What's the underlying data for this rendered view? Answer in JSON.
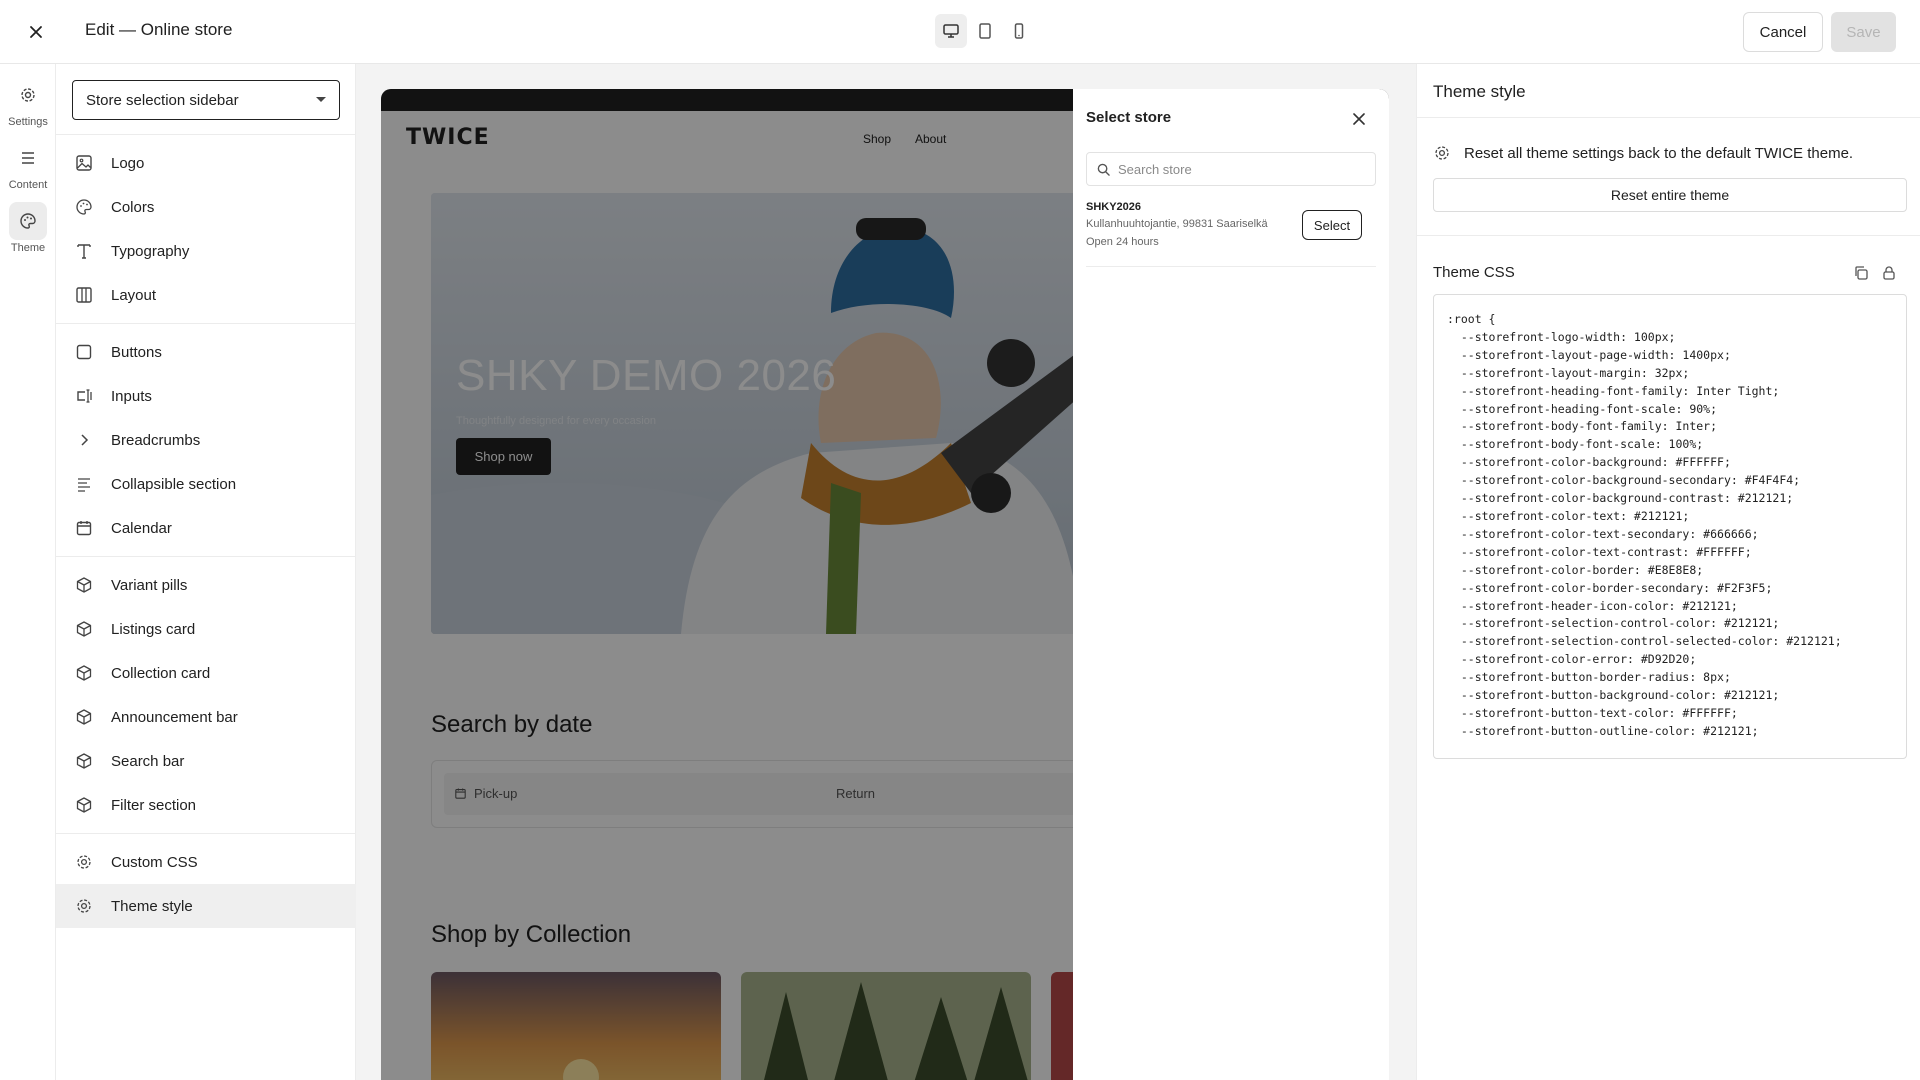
{
  "topbar": {
    "title": "Edit — Online store",
    "cancel_label": "Cancel",
    "save_label": "Save",
    "devices": [
      "desktop-icon",
      "tablet-icon",
      "mobile-icon"
    ]
  },
  "rail": {
    "items": [
      {
        "label": "Settings",
        "icon": "gear-icon"
      },
      {
        "label": "Content",
        "icon": "content-icon"
      },
      {
        "label": "Theme",
        "icon": "palette-icon",
        "active": true
      }
    ]
  },
  "leftpanel": {
    "select_value": "Store selection sidebar",
    "groups": [
      [
        "Logo",
        "Colors",
        "Typography",
        "Layout"
      ],
      [
        "Buttons",
        "Inputs",
        "Breadcrumbs",
        "Collapsible section",
        "Calendar"
      ],
      [
        "Variant pills",
        "Listings card",
        "Collection card",
        "Announcement bar",
        "Search bar",
        "Filter section"
      ],
      [
        "Custom CSS",
        "Theme style"
      ]
    ],
    "active_item": "Theme style"
  },
  "preview": {
    "logo": "TWICE",
    "nav": [
      "Shop",
      "About"
    ],
    "hero_title": "SHKY DEMO 2026",
    "hero_subtitle": "Thoughtfully designed for every occasion",
    "hero_button": "Shop now",
    "section_date": "Search by date",
    "pickup_label": "Pick-up",
    "return_label": "Return",
    "section_collection": "Shop by Collection"
  },
  "drawer": {
    "title": "Select store",
    "search_placeholder": "Search store",
    "stores": [
      {
        "name": "SHKY2026",
        "address": "Kullanhuuhtojantie, 99831 Saariselkä",
        "hours": "Open 24 hours",
        "button": "Select"
      }
    ]
  },
  "rightpanel": {
    "title": "Theme style",
    "reset_text": "Reset all theme settings back to the default TWICE theme.",
    "reset_button": "Reset entire theme",
    "css_title": "Theme CSS",
    "css_code": ":root {\n  --storefront-logo-width: 100px;\n  --storefront-layout-page-width: 1400px;\n  --storefront-layout-margin: 32px;\n  --storefront-heading-font-family: Inter Tight;\n  --storefront-heading-font-scale: 90%;\n  --storefront-body-font-family: Inter;\n  --storefront-body-font-scale: 100%;\n  --storefront-color-background: #FFFFFF;\n  --storefront-color-background-secondary: #F4F4F4;\n  --storefront-color-background-contrast: #212121;\n  --storefront-color-text: #212121;\n  --storefront-color-text-secondary: #666666;\n  --storefront-color-text-contrast: #FFFFFF;\n  --storefront-color-border: #E8E8E8;\n  --storefront-color-border-secondary: #F2F3F5;\n  --storefront-header-icon-color: #212121;\n  --storefront-selection-control-color: #212121;\n  --storefront-selection-control-selected-color: #212121;\n  --storefront-color-error: #D92D20;\n  --storefront-button-border-radius: 8px;\n  --storefront-button-background-color: #212121;\n  --storefront-button-text-color: #FFFFFF;\n  --storefront-button-outline-color: #212121;"
  }
}
